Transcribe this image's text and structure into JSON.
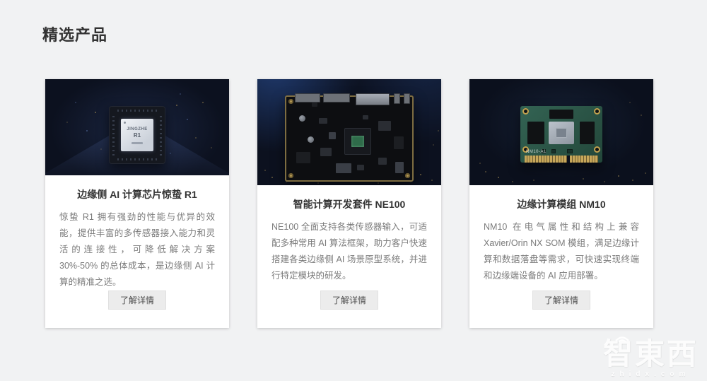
{
  "page": {
    "heading": "精选产品"
  },
  "cards": [
    {
      "title": "边缘侧 AI 计算芯片惊蛰 R1",
      "description": "惊蛰 R1 拥有强劲的性能与优异的效能，提供丰富的多传感器接入能力和灵活的连接性，可降低解决方案 30%-50% 的总体成本，是边缘侧 AI 计算的精准之选。",
      "button_label": "了解详情",
      "image": {
        "type": "ai-chip",
        "die_line1": "JINGZHE",
        "die_line2": "R1"
      }
    },
    {
      "title": "智能计算开发套件 NE100",
      "description": "NE100 全面支持各类传感器输入，可适配多种常用 AI 算法框架，助力客户快速搭建各类边缘侧 AI 场景原型系统，并进行特定模块的研发。",
      "button_label": "了解详情",
      "image": {
        "type": "devkit-board"
      }
    },
    {
      "title": "边缘计算模组 NM10",
      "description": "NM10 在电气属性和结构上兼容 Xavier/Orin NX SOM 模组，满足边缘计算和数据落盘等需求，可快速实现终端和边缘端设备的 AI 应用部署。",
      "button_label": "了解详情",
      "image": {
        "type": "som-module",
        "board_label": "NM10-A1"
      }
    }
  ],
  "watermark": {
    "logo_text": "智東西",
    "domain": "zhidx.com"
  },
  "colors": {
    "page_background": "#f1f2f3",
    "card_background": "#ffffff",
    "media_background": "#0c111f",
    "title_text": "#333333",
    "description_text": "#7b7b7b",
    "button_background": "#ececec",
    "gold_accent": "#c3a24f"
  }
}
